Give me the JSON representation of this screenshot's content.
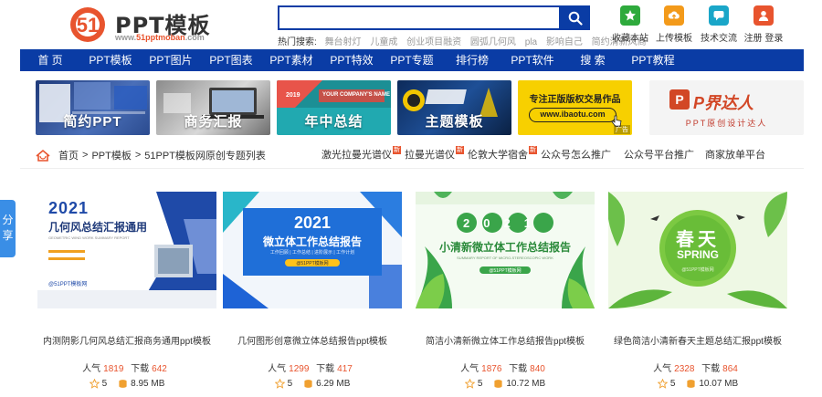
{
  "logo": {
    "name": "PPT模板",
    "mark": "51",
    "url_prefix": "www.",
    "url_brand": "51pptmoban",
    "url_suffix": ".com"
  },
  "search": {
    "value": "",
    "placeholder": ""
  },
  "hot": {
    "label": "热门搜索:",
    "items": [
      "舞台射灯",
      "儿童成",
      "创业项目融资",
      "圆弧几何风",
      "pla",
      "影响自己",
      "简约清新风商"
    ]
  },
  "quick": [
    {
      "label": "收藏本站",
      "icon": "star-icon",
      "color": "#2eaa3c"
    },
    {
      "label": "上传模板",
      "icon": "upload-icon",
      "color": "#f39a1a"
    },
    {
      "label": "技术交流",
      "icon": "chat-icon",
      "color": "#1aa6c8"
    },
    {
      "label": "注册 登录",
      "icon": "user-icon",
      "color": "#e8542e"
    }
  ],
  "nav": [
    "首 页",
    "PPT模板",
    "PPT图片",
    "PPT图表",
    "PPT素材",
    "PPT特效",
    "PPT专题",
    "排行榜",
    "PPT软件",
    "搜 索",
    "PPT教程"
  ],
  "banners": [
    {
      "caption": "简约PPT"
    },
    {
      "caption": "商务汇报"
    },
    {
      "caption": "年中总结",
      "small": "YOUR COMPANY'S NAME",
      "year": "2019"
    },
    {
      "caption": "主题模板"
    },
    {
      "title": "专注正版版权交易作品",
      "url": "www.ibaotu.com",
      "ad": "广告"
    },
    {
      "logo": "P界达人",
      "sub": "PPT原创设计达人"
    }
  ],
  "breadcrumb": [
    "首页",
    "PPT模板",
    "51PPT模板网原创专题列表"
  ],
  "tags": [
    {
      "label": "激光拉曼光谱仪",
      "new": "新"
    },
    {
      "label": "拉曼光谱仪",
      "new": "新"
    },
    {
      "label": "伦敦大学宿舍",
      "new": "新"
    },
    {
      "label": "公众号怎么推广"
    },
    {
      "label": "公众号平台推广"
    },
    {
      "label": "商家放单平台"
    }
  ],
  "share": "分享",
  "stats_labels": {
    "popularity": "人气",
    "downloads": "下载"
  },
  "cards": [
    {
      "title": "内测阴影几何风总结汇报商务通用ppt模板",
      "views": "1819",
      "downloads": "642",
      "stars": "5",
      "size": "8.95 MB",
      "thumb": {
        "year": "2021",
        "heading": "几何风总结汇报通用",
        "sub": "GEOMETRIC WIND WORK SUMMARY REPORT",
        "author": "@51PPT模板网"
      }
    },
    {
      "title": "几何图形创意微立体总结报告ppt模板",
      "views": "1299",
      "downloads": "417",
      "stars": "5",
      "size": "6.29 MB",
      "thumb": {
        "year": "2021",
        "heading": "微立体工作总结报告",
        "sub": "工作回顾 | 工作总结 | 进阶展示 | 工作计划",
        "author": "@51PPT模板网"
      }
    },
    {
      "title": "简洁小清新微立体工作总结报告ppt模板",
      "views": "1876",
      "downloads": "840",
      "stars": "5",
      "size": "10.72 MB",
      "thumb": {
        "year": "2021",
        "heading": "小清新微立体工作总结报告",
        "sub": "SUMMARY REPORT OF MICRO-STEREOSCOPIC WORK",
        "author": "@51PPT模板网"
      }
    },
    {
      "title": "绿色简洁小清新春天主题总结汇报ppt模板",
      "views": "2328",
      "downloads": "864",
      "stars": "5",
      "size": "10.07 MB",
      "thumb": {
        "heading": "春天",
        "sub": "SPRING",
        "author": "@51PPT模板网"
      }
    }
  ]
}
